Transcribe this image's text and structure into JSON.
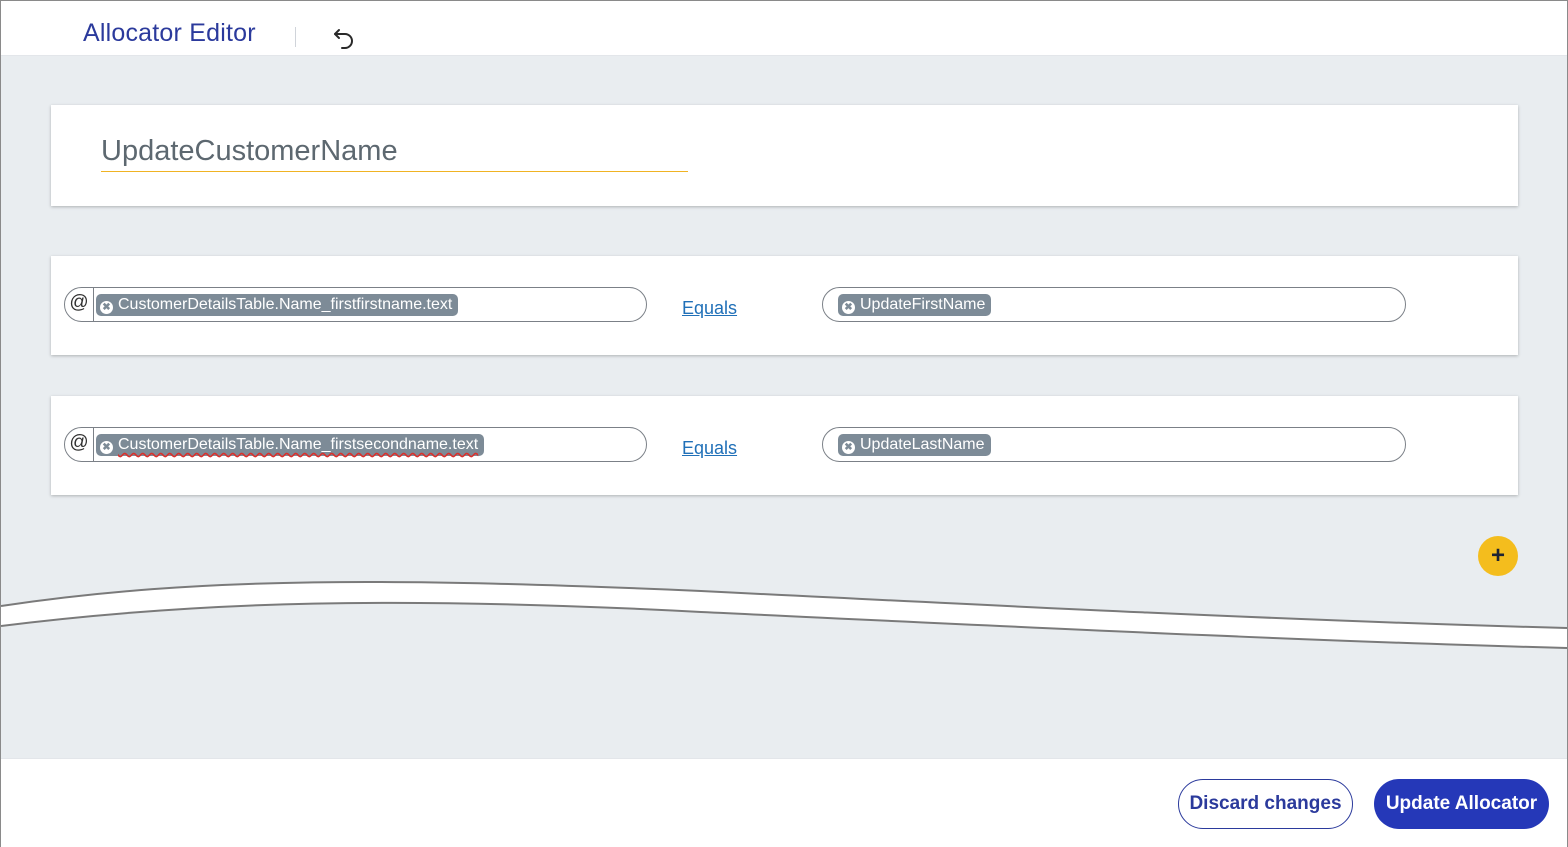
{
  "header": {
    "title": "Allocator Editor",
    "undo_icon": "undo-icon"
  },
  "allocator": {
    "name": "UpdateCustomerName"
  },
  "rules": [
    {
      "prefix_symbol": "@",
      "left_token": "CustomerDetailsTable.Name_firstfirstname.text",
      "operator": "Equals",
      "right_token": "UpdateFirstName"
    },
    {
      "prefix_symbol": "@",
      "left_token": "CustomerDetailsTable.Name_firstsecondname.text",
      "operator": "Equals",
      "right_token": "UpdateLastName"
    }
  ],
  "add_button": {
    "symbol": "+"
  },
  "footer": {
    "discard_label": "Discard changes",
    "update_label": "Update Allocator"
  },
  "colors": {
    "primary": "#2538b8",
    "accent_add": "#f4bd1d",
    "chip": "#7d8b97",
    "underline": "#f0b323",
    "link": "#2070b8",
    "canvas": "#e9edf0"
  }
}
